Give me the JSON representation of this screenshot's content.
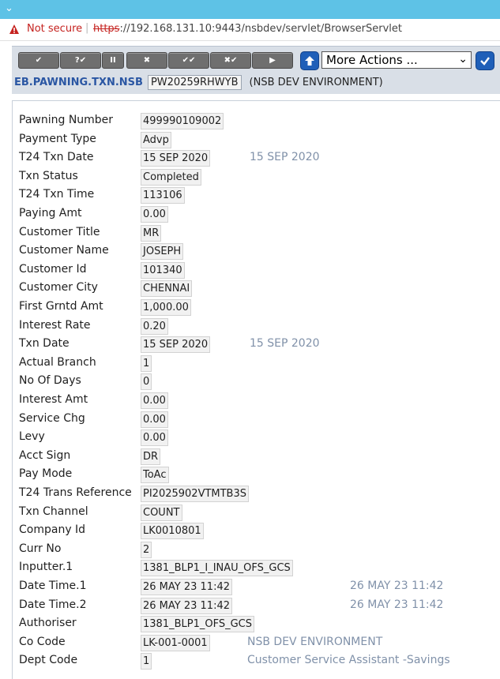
{
  "browser": {
    "not_secure": "Not secure",
    "url_scheme": "https",
    "url_rest": "://192.168.131.10:9443/nsbdev/servlet/BrowserServlet"
  },
  "toolbar": {
    "buttons": [
      {
        "name": "commit-button",
        "glyph": "✔"
      },
      {
        "name": "validate-button",
        "glyph": "?✔"
      },
      {
        "name": "hold-button",
        "glyph": "II"
      },
      {
        "name": "delete-button",
        "glyph": "✖"
      },
      {
        "name": "authorise-button",
        "glyph": "✔✔"
      },
      {
        "name": "reverse-button",
        "glyph": "✖✔"
      },
      {
        "name": "next-button",
        "glyph": "▶"
      }
    ],
    "more_actions": "More Actions ..."
  },
  "app": {
    "application": "EB.PAWNING.TXN.NSB",
    "record_id": "PW20259RHWYB",
    "environment": "(NSB DEV ENVIRONMENT)"
  },
  "fields": [
    {
      "label": "Pawning Number",
      "value": "499990109002",
      "extra": ""
    },
    {
      "label": "Payment Type",
      "value": "Advp",
      "extra": ""
    },
    {
      "label": "T24 Txn Date",
      "value": "15 SEP 2020",
      "extra": "15 SEP 2020"
    },
    {
      "label": "Txn Status",
      "value": "Completed",
      "extra": ""
    },
    {
      "label": "T24 Txn Time",
      "value": "113106",
      "extra": ""
    },
    {
      "label": "Paying Amt",
      "value": "0.00",
      "extra": ""
    },
    {
      "label": "Customer Title",
      "value": "MR",
      "extra": ""
    },
    {
      "label": "Customer Name",
      "value": "JOSEPH",
      "extra": ""
    },
    {
      "label": "Customer Id",
      "value": "101340",
      "extra": ""
    },
    {
      "label": "Customer City",
      "value": "CHENNAI",
      "extra": ""
    },
    {
      "label": "First Grntd Amt",
      "value": "1,000.00",
      "extra": ""
    },
    {
      "label": "Interest Rate",
      "value": "0.20",
      "extra": ""
    },
    {
      "label": "Txn Date",
      "value": "15 SEP 2020",
      "extra": "15 SEP 2020"
    },
    {
      "label": "Actual Branch",
      "value": "1",
      "extra": ""
    },
    {
      "label": "No Of Days",
      "value": "0",
      "extra": ""
    },
    {
      "label": "Interest Amt",
      "value": "0.00",
      "extra": ""
    },
    {
      "label": "Service Chg",
      "value": "0.00",
      "extra": ""
    },
    {
      "label": "Levy",
      "value": "0.00",
      "extra": ""
    },
    {
      "label": "Acct Sign",
      "value": "DR",
      "extra": ""
    },
    {
      "label": "Pay Mode",
      "value": "ToAc",
      "extra": ""
    },
    {
      "label": "T24 Trans Reference",
      "value": "PI2025902VTMTB3S",
      "extra": ""
    },
    {
      "label": "Txn Channel",
      "value": "COUNT",
      "extra": ""
    },
    {
      "label": "Company Id",
      "value": "LK0010801",
      "extra": ""
    },
    {
      "label": "Curr No",
      "value": "2",
      "extra": ""
    },
    {
      "label": "Inputter.1",
      "value": "1381_BLP1_I_INAU_OFS_GCS",
      "extra": ""
    },
    {
      "label": "Date Time.1",
      "value": "26 MAY 23 11:42",
      "extra": "26 MAY 23 11:42"
    },
    {
      "label": "Date Time.2",
      "value": "26 MAY 23 11:42",
      "extra": "26 MAY 23 11:42"
    },
    {
      "label": "Authoriser",
      "value": "1381_BLP1_OFS_GCS",
      "extra": ""
    },
    {
      "label": "Co Code",
      "value": "LK-001-0001",
      "extra": "NSB DEV ENVIRONMENT"
    },
    {
      "label": "Dept Code",
      "value": "1",
      "extra": "Customer Service Assistant -Savings"
    }
  ]
}
